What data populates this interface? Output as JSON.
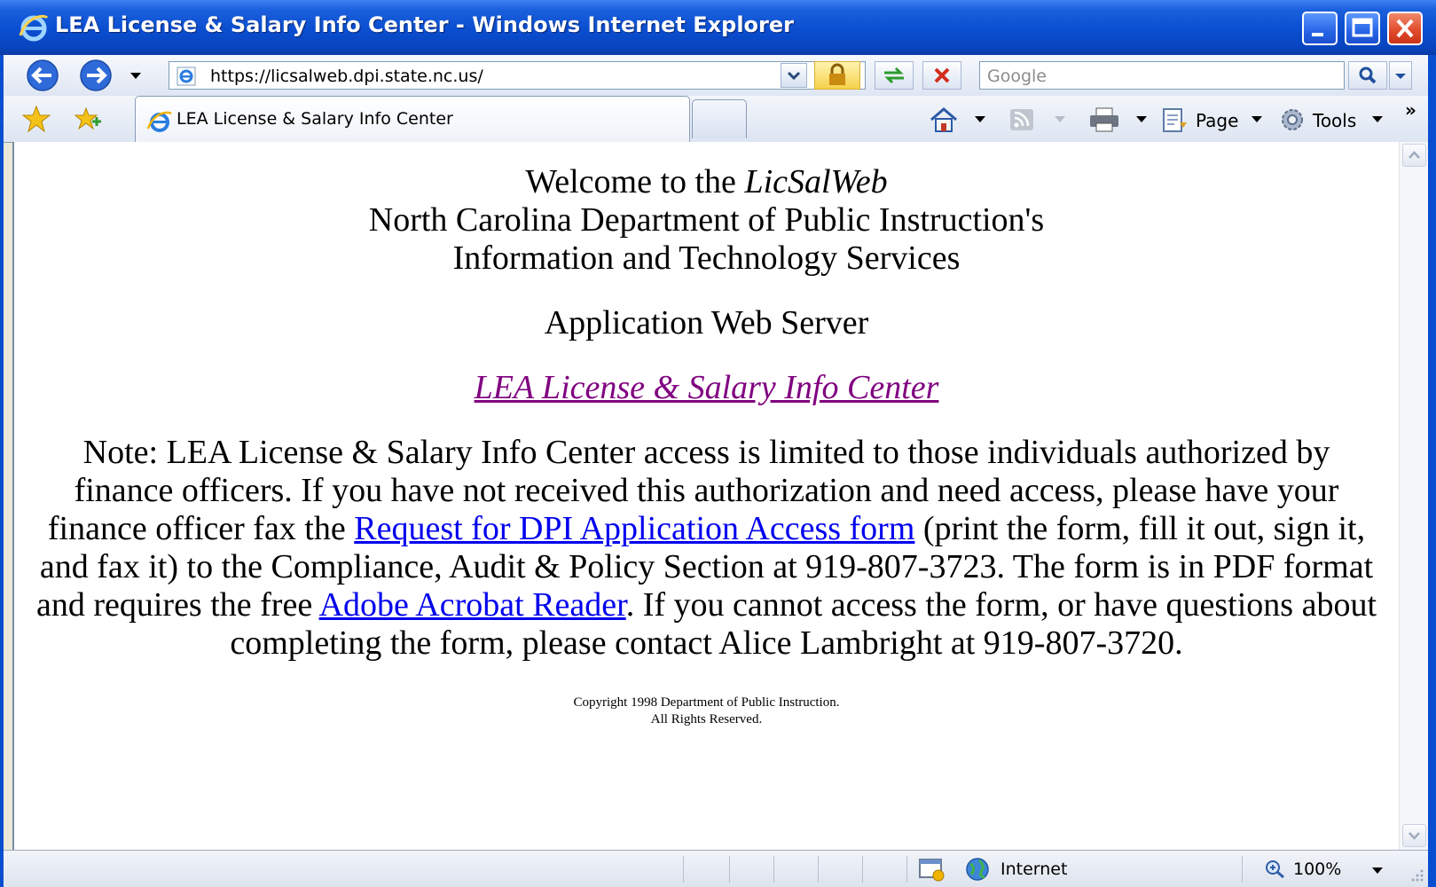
{
  "window": {
    "title": "LEA License & Salary Info Center - Windows Internet Explorer"
  },
  "navbar": {
    "address": "https://licsalweb.dpi.state.nc.us/",
    "search_placeholder": "Google"
  },
  "tabs": [
    {
      "label": "LEA License & Salary Info Center",
      "active": true
    }
  ],
  "commandbar": {
    "page_label": "Page",
    "tools_label": "Tools",
    "overflow": "»"
  },
  "page": {
    "welcome_prefix": "Welcome to the ",
    "welcome_em": "LicSalWeb",
    "line2": "North Carolina Department of Public Instruction's",
    "line3": "Information and Technology Services",
    "app_server": "Application Web Server",
    "lea_link": "LEA License & Salary Info Center",
    "note_1": "Note: LEA License & Salary Info Center access is limited to those individuals authorized by finance officers. If you have not received this authorization and need access, please have your finance officer fax the ",
    "request_link": "Request for DPI Application Access form",
    "note_2": " (print the form, fill it out, sign it, and fax it) to the Compliance, Audit & Policy Section at 919-807-3723. The form is in PDF format and requires the free ",
    "acrobat_link": "Adobe Acrobat Reader",
    "note_3": ". If you cannot access the form, or have questions about completing the form, please contact Alice Lambright at 919-807-3720.",
    "copyright_1": "Copyright 1998 Department of Public Instruction.",
    "copyright_2": "All Rights Reserved."
  },
  "status": {
    "zone": "Internet",
    "zoom": "100%"
  },
  "colors": {
    "titlebar": "#0a4ed0",
    "visited_link": "#800080",
    "link": "#0000ee"
  }
}
